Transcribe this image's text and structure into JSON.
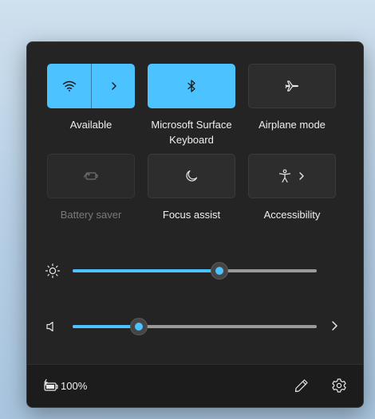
{
  "quick_settings": {
    "tiles": [
      {
        "name": "wifi",
        "label": "Available",
        "state": "on",
        "icon": "wifi-icon"
      },
      {
        "name": "bluetooth",
        "label": "Microsoft Surface Keyboard",
        "state": "on",
        "icon": "bluetooth-icon"
      },
      {
        "name": "airplane",
        "label": "Airplane mode",
        "state": "off",
        "icon": "airplane-icon"
      },
      {
        "name": "battery-saver",
        "label": "Battery saver",
        "state": "disabled",
        "icon": "battery-saver-icon"
      },
      {
        "name": "focus-assist",
        "label": "Focus assist",
        "state": "off",
        "icon": "moon-icon"
      },
      {
        "name": "accessibility",
        "label": "Accessibility",
        "state": "off",
        "icon": "accessibility-icon"
      }
    ],
    "brightness": {
      "icon": "sun-icon",
      "level": 0.6
    },
    "volume": {
      "icon": "speaker-icon",
      "level": 0.27
    },
    "footer": {
      "battery_icon": "battery-charging-icon",
      "battery_percent": "100%",
      "edit_icon": "pencil-icon",
      "settings_icon": "gear-icon"
    },
    "colors": {
      "accent": "#4cc2ff",
      "panel": "#242424",
      "footer": "#1c1c1c"
    }
  }
}
